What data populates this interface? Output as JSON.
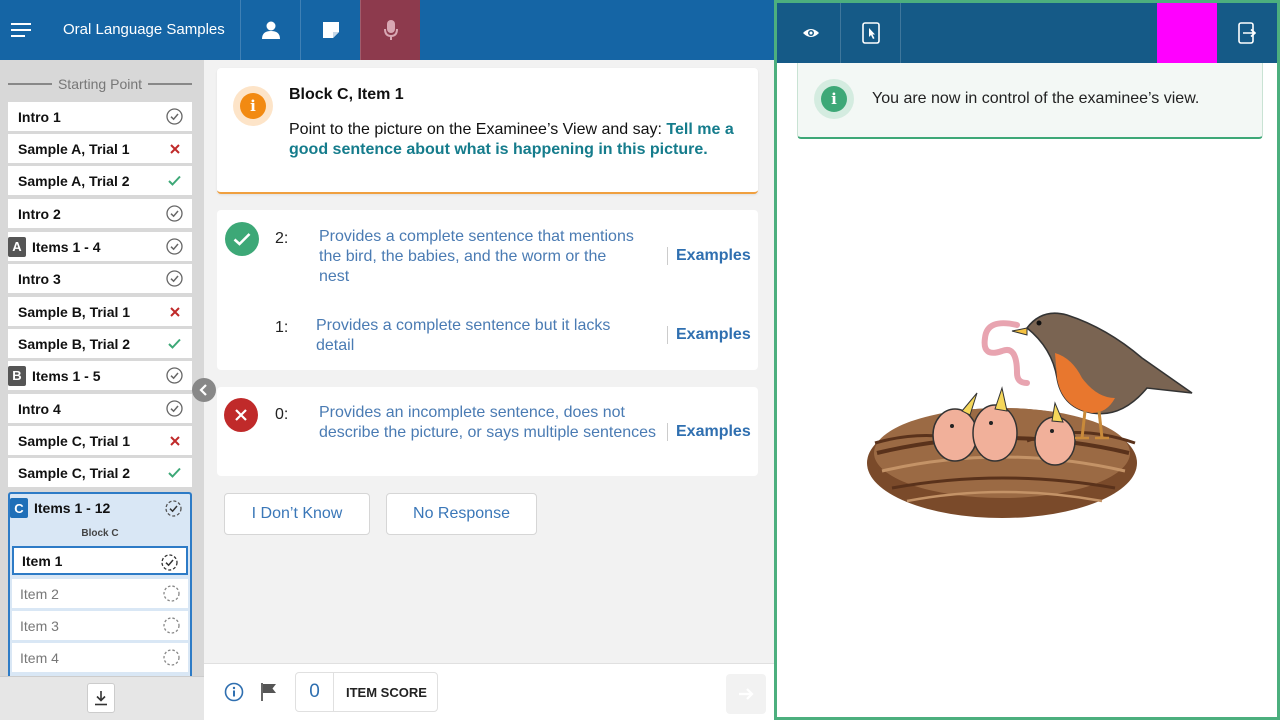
{
  "header": {
    "title": "Oral Language Samples"
  },
  "sidebar": {
    "section_title": "Starting Point",
    "items": [
      {
        "label": "Intro 1",
        "status": "done"
      },
      {
        "label": "Sample A, Trial 1",
        "status": "wrong"
      },
      {
        "label": "Sample A, Trial 2",
        "status": "correct"
      },
      {
        "label": "Intro 2",
        "status": "done"
      },
      {
        "label": "Items 1 - 4",
        "badge": "A",
        "status": "done"
      },
      {
        "label": "Intro 3",
        "status": "done"
      },
      {
        "label": "Sample B, Trial 1",
        "status": "wrong"
      },
      {
        "label": "Sample B, Trial 2",
        "status": "correct"
      },
      {
        "label": "Items 1 - 5",
        "badge": "B",
        "status": "done"
      },
      {
        "label": "Intro 4",
        "status": "done"
      },
      {
        "label": "Sample C, Trial 1",
        "status": "wrong"
      },
      {
        "label": "Sample C, Trial 2",
        "status": "correct"
      }
    ],
    "block_c": {
      "badge": "C",
      "label": "Items 1 - 12",
      "sublabel": "Block C",
      "items": [
        "Item 1",
        "Item 2",
        "Item 3",
        "Item 4"
      ]
    }
  },
  "prompt": {
    "title": "Block C, Item 1",
    "instruction": "Point to the picture on the Examinee’s View and say: ",
    "say": "Tell me a good sentence about what is happening in this picture."
  },
  "scores": [
    {
      "value": "2:",
      "description": "Provides a complete sentence that mentions the bird, the babies, and the worm or the nest",
      "link": "Examples"
    },
    {
      "value": "1:",
      "description": "Provides a complete sentence but it lacks detail",
      "link": "Examples"
    },
    {
      "value": "0:",
      "description": "Provides an incomplete sentence, does not describe the picture, or says multiple sentences",
      "link": "Examples"
    }
  ],
  "responses": {
    "dont_know": "I Don’t Know",
    "no_response": "No Response"
  },
  "footer": {
    "item_score_value": "0",
    "item_score_label": "ITEM SCORE"
  },
  "examinee": {
    "notice": "You are now in control of the examinee’s view."
  },
  "colors": {
    "header_blue": "#1565a5",
    "active_tab": "#8d3a4d",
    "right_header": "#155a87",
    "highlight": "#ff00ff",
    "correct": "#3da877",
    "wrong": "#c02a2a",
    "prompt_accent": "#f28a12",
    "say_text": "#157c8c"
  }
}
